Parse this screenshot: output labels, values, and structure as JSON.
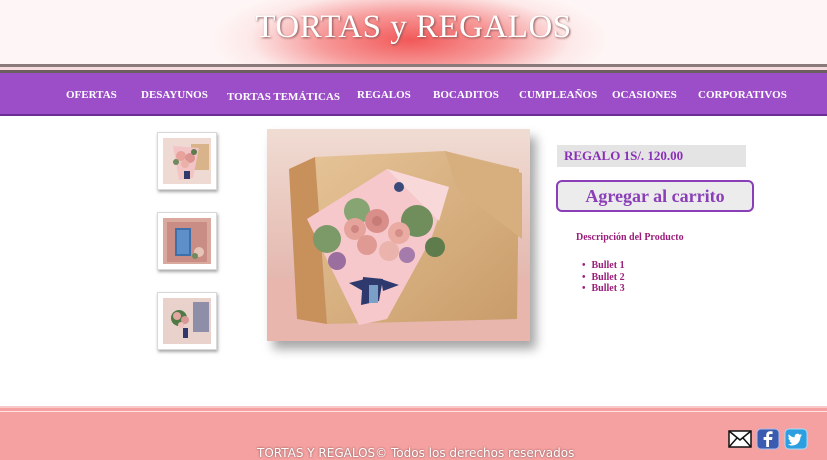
{
  "header": {
    "title": "TORTAS y REGALOS"
  },
  "nav": {
    "items": [
      {
        "label": "OFERTAS"
      },
      {
        "label": "DESAYUNOS"
      },
      {
        "label": "TORTAS TEMÁTICAS"
      },
      {
        "label": "REGALOS"
      },
      {
        "label": "BOCADITOS"
      },
      {
        "label": "CUMPLEAÑOS"
      },
      {
        "label": "OCASIONES"
      },
      {
        "label": "CORPORATIVOS"
      }
    ]
  },
  "product": {
    "price_label": "REGALO 1S/. 120.00",
    "add_to_cart": "Agregar al carrito",
    "description_title": "Descripción del Producto",
    "bullets": [
      "Bullet 1",
      "Bullet 2",
      "Bullet 3"
    ]
  },
  "footer": {
    "text": "TORTAS Y REGALOS© Todos los derechos reservados"
  },
  "social": {
    "icons": [
      "mail-icon",
      "facebook-icon",
      "twitter-icon"
    ]
  },
  "colors": {
    "nav_bg": "#9b4ec8",
    "accent_purple": "#8a3fb8",
    "footer_bg": "#f6a1a1",
    "description_text": "#9a1f7a"
  }
}
